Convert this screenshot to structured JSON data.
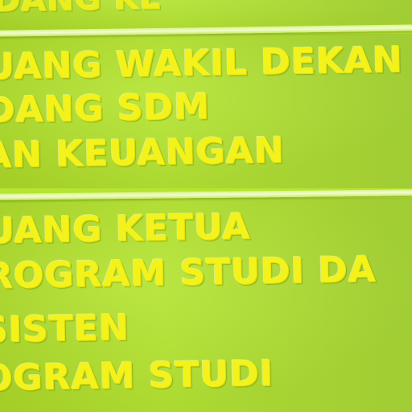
{
  "sign": {
    "top_fragment": "DANG KE",
    "section1": {
      "line1": "UANG WAKIL DEKAN",
      "line2": "DANG SDM",
      "line3": "AN KEUANGAN"
    },
    "section2": {
      "line1": "UANG KETUA",
      "line2": "ROGRAM STUDI DA",
      "line3": "SISTEN",
      "line4": "OGRAM STUDI"
    },
    "colors": {
      "background": "#b6e533",
      "lettering": "#f3f21a",
      "divider": "#f2fbd0"
    }
  }
}
